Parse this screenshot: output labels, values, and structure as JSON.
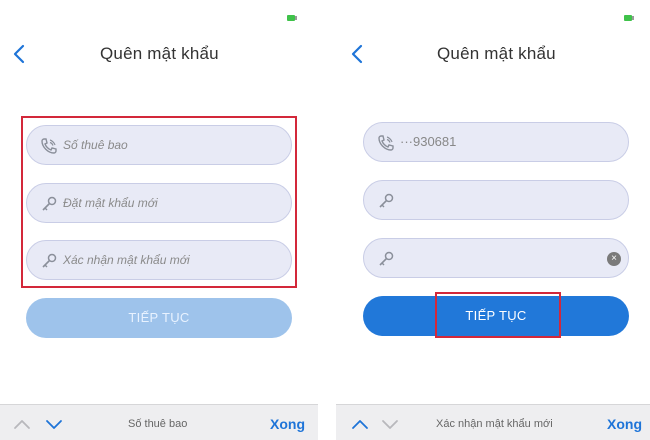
{
  "left": {
    "title": "Quên mật khẩu",
    "phone_placeholder": "Số thuê bao",
    "new_password_placeholder": "Đặt mật khẩu mới",
    "confirm_password_placeholder": "Xác nhận mật khẩu mới",
    "continue_label": "TIẾP TỤC",
    "keyboard_field_label": "Số thuê bao",
    "done_label": "Xong"
  },
  "right": {
    "title": "Quên mật khẩu",
    "phone_value": "···930681",
    "continue_label": "TIẾP TỤC",
    "keyboard_field_label": "Xác nhận mật khẩu mới",
    "done_label": "Xong"
  },
  "colors": {
    "accent": "#2178d9",
    "disabled_button": "#9ec3eb",
    "highlight": "#d3283a",
    "field_bg": "#e8eaf6"
  },
  "icons": {
    "back": "chevron-left-icon",
    "phone": "phone-icon",
    "key": "key-icon",
    "clear": "clear-icon",
    "up": "chevron-up-icon",
    "down": "chevron-down-icon"
  }
}
